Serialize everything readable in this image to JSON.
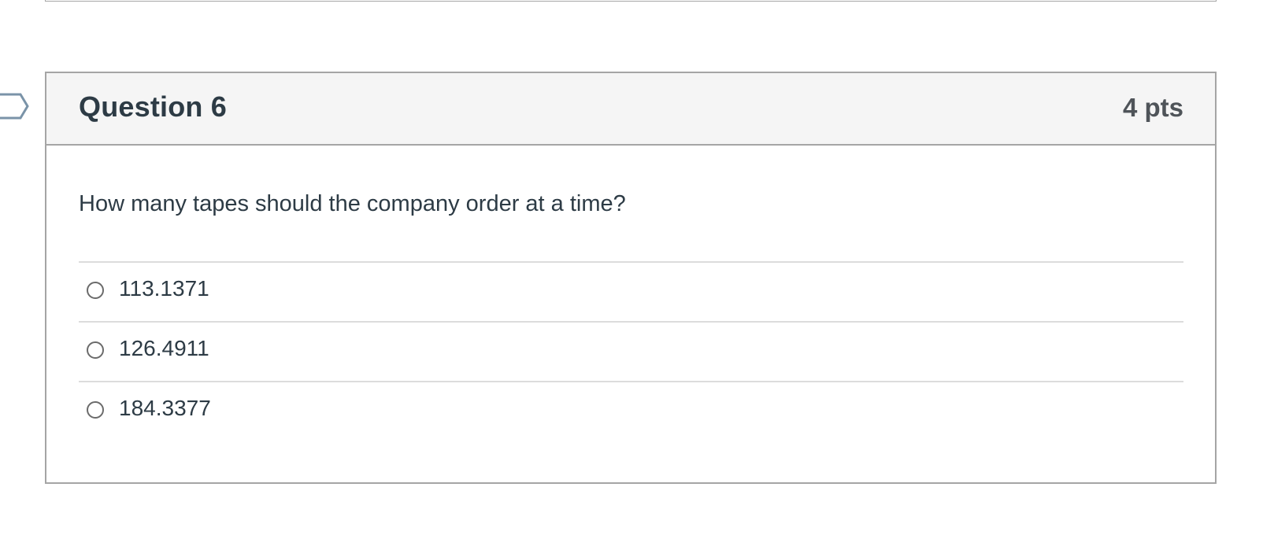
{
  "question": {
    "name": "Question 6",
    "points": "4 pts",
    "text": "How many tapes should the company order at a time?",
    "answers": [
      {
        "label": "113.1371",
        "selected": false
      },
      {
        "label": "126.4911",
        "selected": false
      },
      {
        "label": "184.3377",
        "selected": false
      }
    ]
  },
  "icons": {
    "flag": "flag-question-icon",
    "radio": "radio-unchecked-icon"
  },
  "colors": {
    "header_background": "#f5f5f5",
    "border": "#a5a5a5",
    "text": "#2d3b45",
    "points_text": "#4f5459",
    "flag_outline": "#7a93a8"
  }
}
